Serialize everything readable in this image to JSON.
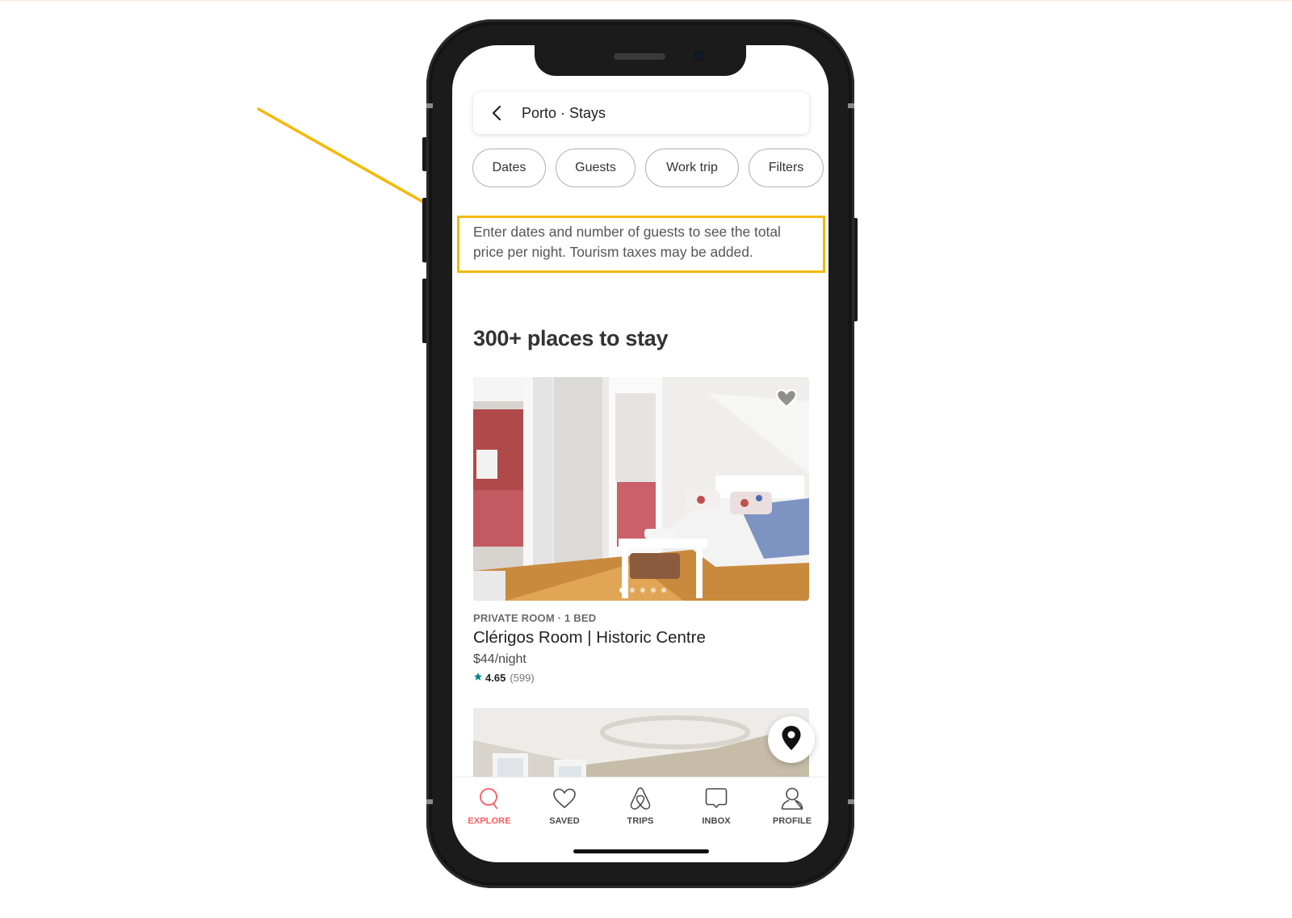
{
  "header": {
    "back_icon": "chevron-left-icon",
    "title": "Porto · Stays"
  },
  "filters": [
    {
      "label": "Dates"
    },
    {
      "label": "Guests"
    },
    {
      "label": "Work trip"
    },
    {
      "label": "Filters"
    }
  ],
  "notice": "Enter dates and number of guests to see the total price per night. Tourism taxes may be added.",
  "results_heading": "300+ places to stay",
  "listings": [
    {
      "photo_count": 5,
      "active_photo": 1,
      "saved_icon": "heart-icon",
      "type": "PRIVATE ROOM · 1 BED",
      "title": "Clérigos Room | Historic Centre",
      "price": "$44/night",
      "rating_icon": "star-icon",
      "rating": "4.65",
      "reviews": "(599)"
    }
  ],
  "map_button_icon": "map-pin-icon",
  "tabbar": {
    "items": [
      {
        "label": "EXPLORE",
        "icon": "search-icon",
        "active": true
      },
      {
        "label": "SAVED",
        "icon": "heart-icon",
        "active": false
      },
      {
        "label": "TRIPS",
        "icon": "airbnb-logo-icon",
        "active": false
      },
      {
        "label": "INBOX",
        "icon": "chat-bubble-icon",
        "active": false
      },
      {
        "label": "PROFILE",
        "icon": "user-icon",
        "active": false
      }
    ]
  },
  "colors": {
    "accent": "#ff5a5f",
    "highlight": "#f4b90a",
    "rating_star": "#008489"
  }
}
